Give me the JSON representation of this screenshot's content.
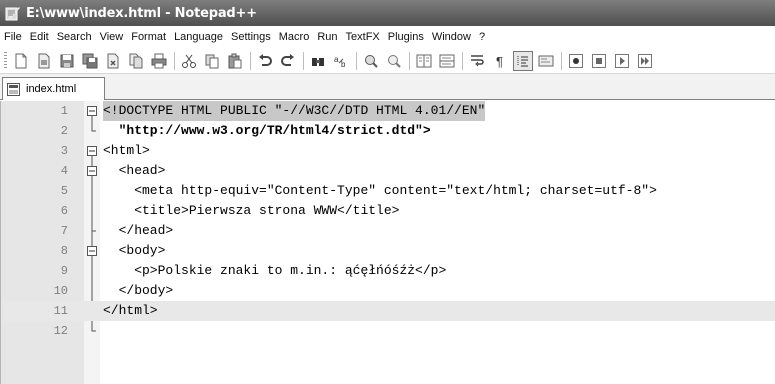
{
  "window": {
    "title": "E:\\www\\index.html - Notepad++"
  },
  "menu": {
    "items": [
      "File",
      "Edit",
      "Search",
      "View",
      "Format",
      "Language",
      "Settings",
      "Macro",
      "Run",
      "TextFX",
      "Plugins",
      "Window",
      "?"
    ]
  },
  "toolbar": {
    "icons": [
      "new-file-icon",
      "open-file-icon",
      "save-icon",
      "save-all-icon",
      "close-icon",
      "close-all-icon",
      "print-icon",
      "cut-icon",
      "copy-icon",
      "paste-icon",
      "undo-icon",
      "redo-icon",
      "find-icon",
      "replace-icon",
      "zoom-in-icon",
      "zoom-out-icon",
      "sync-vertical-icon",
      "sync-horizontal-icon",
      "word-wrap-icon",
      "show-all-chars-icon",
      "indent-guide-icon",
      "user-language-icon",
      "record-macro-icon",
      "stop-macro-icon",
      "play-macro-icon",
      "run-macro-multiple-icon"
    ]
  },
  "tabs": [
    {
      "label": "index.html",
      "active": true
    }
  ],
  "editor": {
    "current_line": 11,
    "lines": [
      {
        "num": "1",
        "text": "<!DOCTYPE HTML PUBLIC \"-//W3C//DTD HTML 4.01//EN\""
      },
      {
        "num": "2",
        "text": "  \"http://www.w3.org/TR/html4/strict.dtd\">"
      },
      {
        "num": "3",
        "text": "<html>"
      },
      {
        "num": "4",
        "text": "  <head>"
      },
      {
        "num": "5",
        "text": "    <meta http-equiv=\"Content-Type\" content=\"text/html; charset=utf-8\">"
      },
      {
        "num": "6",
        "text": "    <title>Pierwsza strona WWW</title>"
      },
      {
        "num": "7",
        "text": "  </head>"
      },
      {
        "num": "8",
        "text": "  <body>"
      },
      {
        "num": "9",
        "text": "    <p>Polskie znaki to m.in.: ąćęłńóśźż</p>"
      },
      {
        "num": "10",
        "text": "  </body>"
      },
      {
        "num": "11",
        "text": "</html>"
      },
      {
        "num": "12",
        "text": ""
      }
    ]
  },
  "colors": {
    "titlebar": "#5e5e5e",
    "gutter": "#e6e6e6",
    "current_line": "#e8e8e8",
    "doctype_highlight": "#c8c8c8"
  }
}
